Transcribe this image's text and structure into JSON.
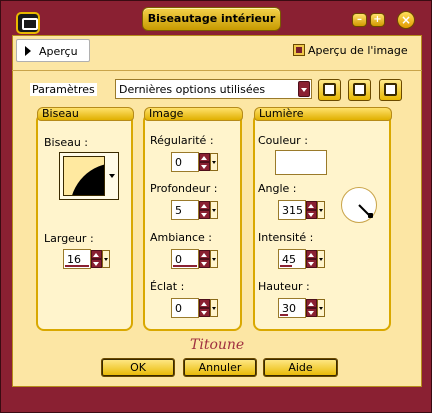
{
  "window": {
    "title": "Biseautage intérieur"
  },
  "preview": {
    "toggle_label": "Aperçu",
    "checkbox_label": "Aperçu de l'image",
    "checked": true
  },
  "params": {
    "label": "Paramètres",
    "preset_value": "Dernières options utilisées"
  },
  "groups": {
    "biseau": {
      "title": "Biseau",
      "bevel_label": "Biseau :",
      "width_label": "Largeur :",
      "width_value": "16"
    },
    "image": {
      "title": "Image",
      "regularity_label": "Régularité :",
      "regularity_value": "0",
      "depth_label": "Profondeur :",
      "depth_value": "5",
      "ambience_label": "Ambiance :",
      "ambience_value": "0",
      "shine_label": "Éclat :",
      "shine_value": "0"
    },
    "lumiere": {
      "title": "Lumière",
      "color_label": "Couleur :",
      "color_value": "#ffffff",
      "angle_label": "Angle :",
      "angle_value": "315",
      "intensity_label": "Intensité :",
      "intensity_value": "45",
      "height_label": "Hauteur :",
      "height_value": "30"
    }
  },
  "watermark": "Titoune",
  "buttons": {
    "ok": "OK",
    "cancel": "Annuler",
    "help": "Aide"
  }
}
